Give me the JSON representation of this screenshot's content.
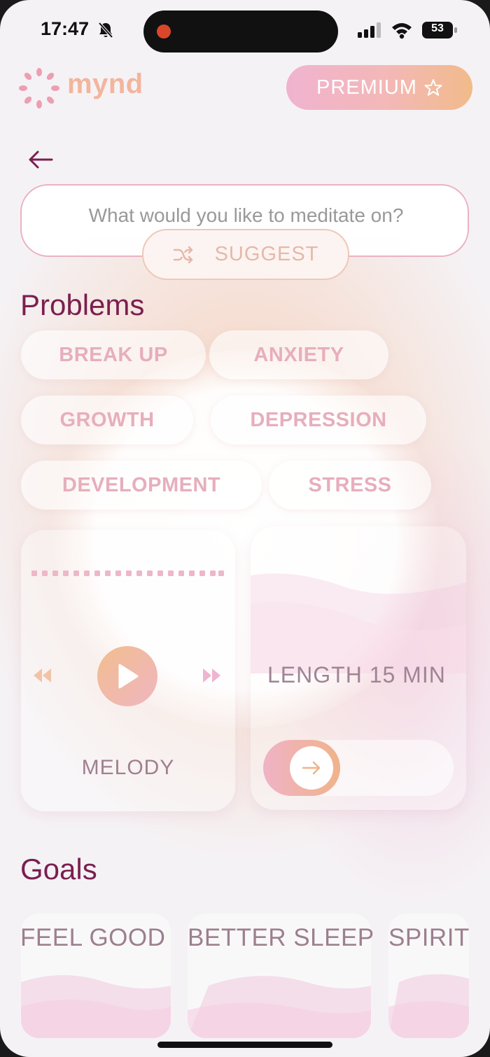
{
  "status_bar": {
    "time": "17:47",
    "battery_level": "53"
  },
  "header": {
    "app_name": "mynd",
    "premium_label": "PREMIUM"
  },
  "search": {
    "placeholder": "What would you like to meditate on?",
    "value": "",
    "suggest_label": "SUGGEST"
  },
  "problems": {
    "title": "Problems",
    "chips": [
      "BREAK UP",
      "ANXIETY",
      "GROWTH",
      "DEPRESSION",
      "DEVELOPMENT",
      "STRESS"
    ]
  },
  "player": {
    "melody_label": "MELODY",
    "length_label": "LENGTH 15 MIN"
  },
  "goals": {
    "title": "Goals",
    "items": [
      "FEEL GOOD",
      "BETTER SLEEP",
      "SPIRIT"
    ]
  },
  "colors": {
    "title": "#7a1f4f",
    "accent_pink": "#efb3c6",
    "accent_peach": "#f2bb8a",
    "chip_text": "#e7aebc"
  },
  "icons": [
    "bell-off-icon",
    "signal-icon",
    "wifi-icon",
    "battery-icon",
    "logo-icon",
    "star-icon",
    "back-arrow-icon",
    "shuffle-icon",
    "rewind-icon",
    "play-icon",
    "fast-forward-icon",
    "arrow-right-icon"
  ]
}
